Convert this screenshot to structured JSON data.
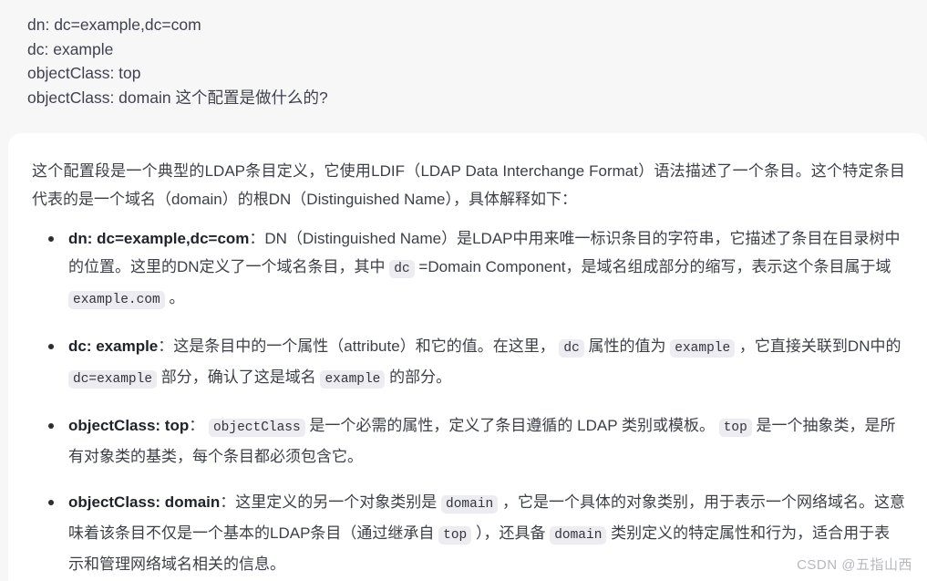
{
  "theme": {
    "page_background": "#f7f7f8",
    "card_background": "#ffffff",
    "text_color": "#3c3f46",
    "code_background": "#ececf1",
    "watermark_color": "#b6b8bd"
  },
  "question": {
    "lines": [
      "dn: dc=example,dc=com",
      "dc: example",
      "objectClass: top",
      "objectClass: domain 这个配置是做什么的?"
    ]
  },
  "answer": {
    "intro": "这个配置段是一个典型的LDAP条目定义，它使用LDIF（LDAP Data Interchange Format）语法描述了一个条目。这个特定条目代表的是一个域名（domain）的根DN（Distinguished Name），具体解释如下：",
    "bullets": [
      {
        "lead": "dn: dc=example,dc=com",
        "seg1": "：DN（Distinguished Name）是LDAP中用来唯一标识条目的字符串，它描述了条目在目录树中的位置。这里的DN定义了一个域名条目，其中 ",
        "code1": "dc",
        "seg2": " =Domain Component，是域名组成部分的缩写，表示这个条目属于域 ",
        "code2": "example.com",
        "seg3": " 。"
      },
      {
        "lead": "dc: example",
        "seg1": "：这是条目中的一个属性（attribute）和它的值。在这里， ",
        "code1": "dc",
        "seg2": " 属性的值为 ",
        "code2": "example",
        "seg3": " ，它直接关联到DN中的 ",
        "code3": "dc=example",
        "seg4": " 部分，确认了这是域名 ",
        "code4": "example",
        "seg5": " 的部分。"
      },
      {
        "lead": "objectClass: top",
        "seg1": "： ",
        "code1": "objectClass",
        "seg2": " 是一个必需的属性，定义了条目遵循的 LDAP 类别或模板。 ",
        "code2": "top",
        "seg3": " 是一个抽象类，是所有对象类的基类，每个条目都必须包含它。"
      },
      {
        "lead": "objectClass: domain",
        "seg1": "：这里定义的另一个对象类别是 ",
        "code1": "domain",
        "seg2": " ，它是一个具体的对象类别，用于表示一个网络域名。这意味着该条目不仅是一个基本的LDAP条目（通过继承自 ",
        "code2": "top",
        "seg3": " ），还具备 ",
        "code3": "domain",
        "seg4": " 类别定义的特定属性和行为，适合用于表示和管理网络域名相关的信息。"
      }
    ]
  },
  "watermark": {
    "text": "CSDN @五指山西"
  }
}
